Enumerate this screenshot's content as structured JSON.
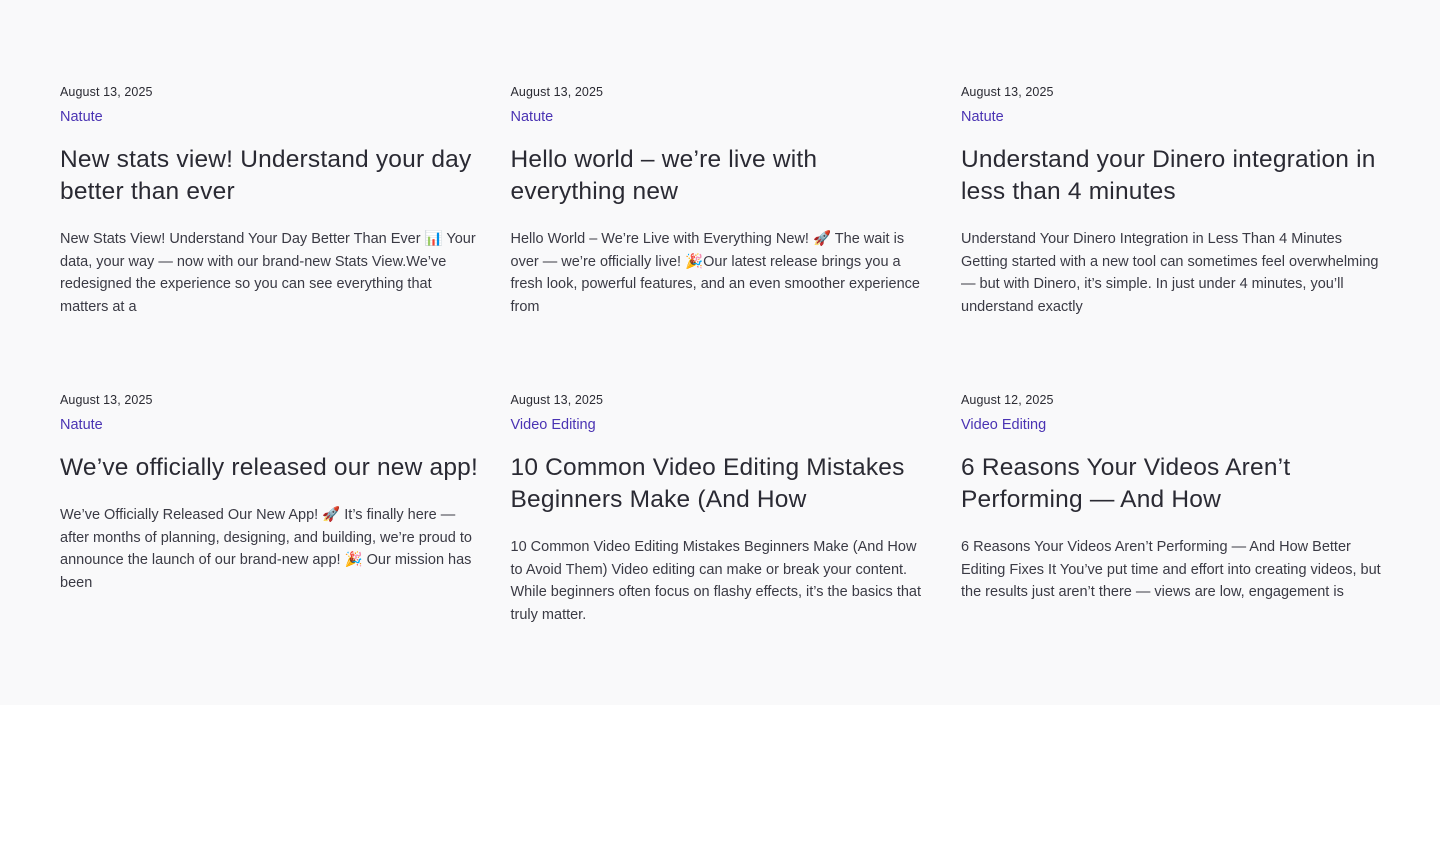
{
  "posts": [
    {
      "date": "August 13, 2025",
      "category": "Natute",
      "title": "New stats view! Understand your day better than ever",
      "excerpt": "New Stats View! Understand Your Day Better Than Ever 📊 Your data, your way — now with our brand-new Stats View.We’ve redesigned the experience so you can see everything that matters at a"
    },
    {
      "date": "August 13, 2025",
      "category": "Natute",
      "title": "Hello world – we’re live with everything new",
      "excerpt": "Hello World – We’re Live with Everything New! 🚀 The wait is over — we’re officially live! 🎉Our latest release brings you a fresh look, powerful features, and an even smoother experience from"
    },
    {
      "date": "August 13, 2025",
      "category": "Natute",
      "title": "Understand your Dinero integration in less than 4 minutes",
      "excerpt": "Understand Your Dinero Integration in Less Than 4 Minutes Getting started with a new tool can sometimes feel overwhelming — but with Dinero, it’s simple. In just under 4 minutes, you’ll understand exactly"
    },
    {
      "date": "August 13, 2025",
      "category": "Natute",
      "title": "We’ve officially released our new app!",
      "excerpt": "We’ve Officially Released Our New App! 🚀 It’s finally here — after months of planning, designing, and building, we’re proud to announce the launch of our brand-new app! 🎉 Our mission has been"
    },
    {
      "date": "August 13, 2025",
      "category": "Video Editing",
      "title": "10 Common Video Editing Mistakes Beginners Make (And How",
      "excerpt": "10 Common Video Editing Mistakes Beginners Make (And How to Avoid Them) Video editing can make or break your content. While beginners often focus on flashy effects, it’s the basics that truly matter."
    },
    {
      "date": "August 12, 2025",
      "category": "Video Editing",
      "title": "6 Reasons Your Videos Aren’t Performing — And How",
      "excerpt": "6 Reasons Your Videos Aren’t Performing — And How Better Editing Fixes It You’ve put time and effort into creating videos, but the results just aren’t there — views are low, engagement is"
    }
  ]
}
